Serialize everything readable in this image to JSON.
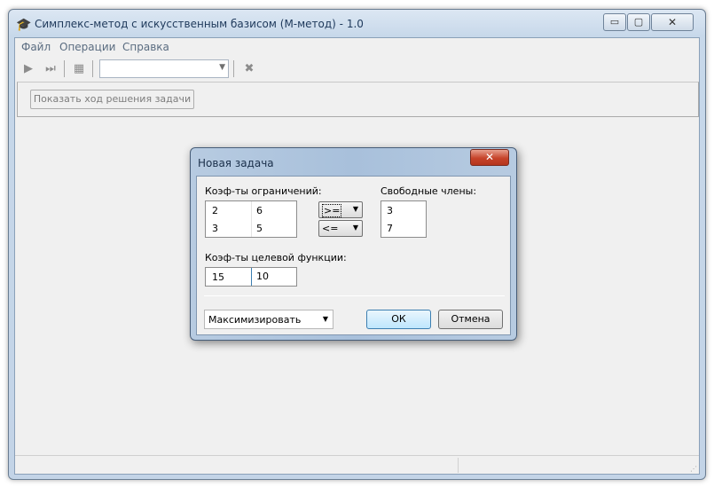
{
  "window": {
    "title": "Симплекс-метод с искусственным базисом (М-метод) - 1.0",
    "icon": "graduation-cap-icon",
    "min_glyph": "▭",
    "max_glyph": "▢",
    "close_glyph": "✕"
  },
  "menu": {
    "file": "Файл",
    "operations": "Операции",
    "help": "Справка"
  },
  "toolbar": {
    "combo_value": "",
    "icons": [
      "play-icon",
      "step-icon",
      "grid-icon",
      "excel-icon"
    ],
    "play_glyph": "▶",
    "step_glyph": "⏭",
    "grid_glyph": "▦",
    "excel_glyph": "✖",
    "arrow_glyph": "▼"
  },
  "panel": {
    "show_solution_label": "Показать ход решения задачи"
  },
  "dialog": {
    "title": "Новая задача",
    "close_glyph": "✕",
    "constraints_label": "Коэф-ты ограничений:",
    "free_terms_label": "Свободные члены:",
    "objective_label": "Коэф-ты целевой функции:",
    "constraints": [
      [
        "2",
        "6"
      ],
      [
        "3",
        "5"
      ]
    ],
    "signs": [
      ">=",
      "<="
    ],
    "free_terms": [
      "3",
      "7"
    ],
    "objective": [
      "15",
      "10"
    ],
    "goal": "Максимизировать",
    "ok_label": "ОК",
    "cancel_label": "Отмена",
    "arrow_glyph": "▼"
  },
  "colors": {
    "title_text": "#1e395b",
    "menu_text": "#5a6c80",
    "disabled_text": "#7d7d7d",
    "client_bg": "#f0f0f0",
    "ok_border": "#3c7fb1",
    "close_red": "#c6432a"
  }
}
